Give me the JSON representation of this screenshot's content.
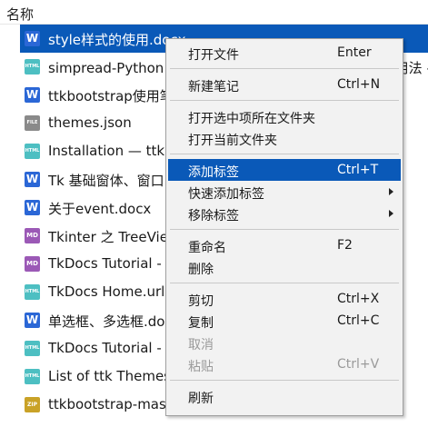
{
  "header": {
    "name_column": "名称"
  },
  "files": [
    {
      "icon": "word-doc-icon",
      "badge": "W",
      "name": "style样式的使用.docx",
      "selected": true
    },
    {
      "icon": "html-file-icon",
      "badge": "HTML",
      "name": "simpread-Python 中 tkinter 组件 ttk.Treeview 的基本用法 - 知乎_column"
    },
    {
      "icon": "word-doc-icon",
      "badge": "W",
      "name": "ttkbootstrap使用笔记.docx"
    },
    {
      "icon": "generic-file-icon",
      "badge": "FILE",
      "name": "themes.json"
    },
    {
      "icon": "html-file-icon",
      "badge": "HTML",
      "name": "Installation — ttkbootstrap.html"
    },
    {
      "icon": "word-doc-icon",
      "badge": "W",
      "name": "Tk 基础窗体、窗口.docx"
    },
    {
      "icon": "word-doc-icon",
      "badge": "W",
      "name": "关于event.docx"
    },
    {
      "icon": "markdown-file-icon",
      "badge": "MD",
      "name": "Tkinter 之 TreeView.md"
    },
    {
      "icon": "markdown-file-icon",
      "badge": "MD",
      "name": "TkDocs Tutorial - Styles.md"
    },
    {
      "icon": "html-file-icon",
      "badge": "HTML",
      "name": "TkDocs Home.url"
    },
    {
      "icon": "word-doc-icon",
      "badge": "W",
      "name": "单选框、多选框.docx"
    },
    {
      "icon": "html-file-icon",
      "badge": "HTML",
      "name": "TkDocs Tutorial - Styles.html"
    },
    {
      "icon": "html-file-icon",
      "badge": "HTML",
      "name": "List of ttk Themes.html"
    },
    {
      "icon": "zip-file-icon",
      "badge": "ZIP",
      "name": "ttkbootstrap-master.zip"
    }
  ],
  "menu": {
    "items": [
      {
        "id": "open-file",
        "label": "打开文件",
        "shortcut": "Enter"
      },
      {
        "sep": true
      },
      {
        "id": "new-note",
        "label": "新建笔记",
        "shortcut": "Ctrl+N"
      },
      {
        "sep": true
      },
      {
        "id": "open-containing-folder",
        "label": "打开选中项所在文件夹"
      },
      {
        "id": "open-current-folder",
        "label": "打开当前文件夹"
      },
      {
        "sep": true
      },
      {
        "id": "add-tag",
        "label": "添加标签",
        "shortcut": "Ctrl+T",
        "highlighted": true
      },
      {
        "id": "quick-add-tag",
        "label": "快速添加标签",
        "submenu": true
      },
      {
        "id": "remove-tag",
        "label": "移除标签",
        "submenu": true
      },
      {
        "sep": true
      },
      {
        "id": "rename",
        "label": "重命名",
        "shortcut": "F2"
      },
      {
        "id": "delete",
        "label": "删除"
      },
      {
        "sep": true
      },
      {
        "id": "cut",
        "label": "剪切",
        "shortcut": "Ctrl+X"
      },
      {
        "id": "copy",
        "label": "复制",
        "shortcut": "Ctrl+C"
      },
      {
        "id": "undo",
        "label": "取消",
        "disabled": true
      },
      {
        "id": "paste",
        "label": "粘贴",
        "shortcut": "Ctrl+V",
        "disabled": true
      },
      {
        "sep": true
      },
      {
        "id": "refresh",
        "label": "刷新"
      }
    ]
  },
  "colors": {
    "selection": "#0a59b8",
    "menu_bg": "#f2f2f2"
  }
}
